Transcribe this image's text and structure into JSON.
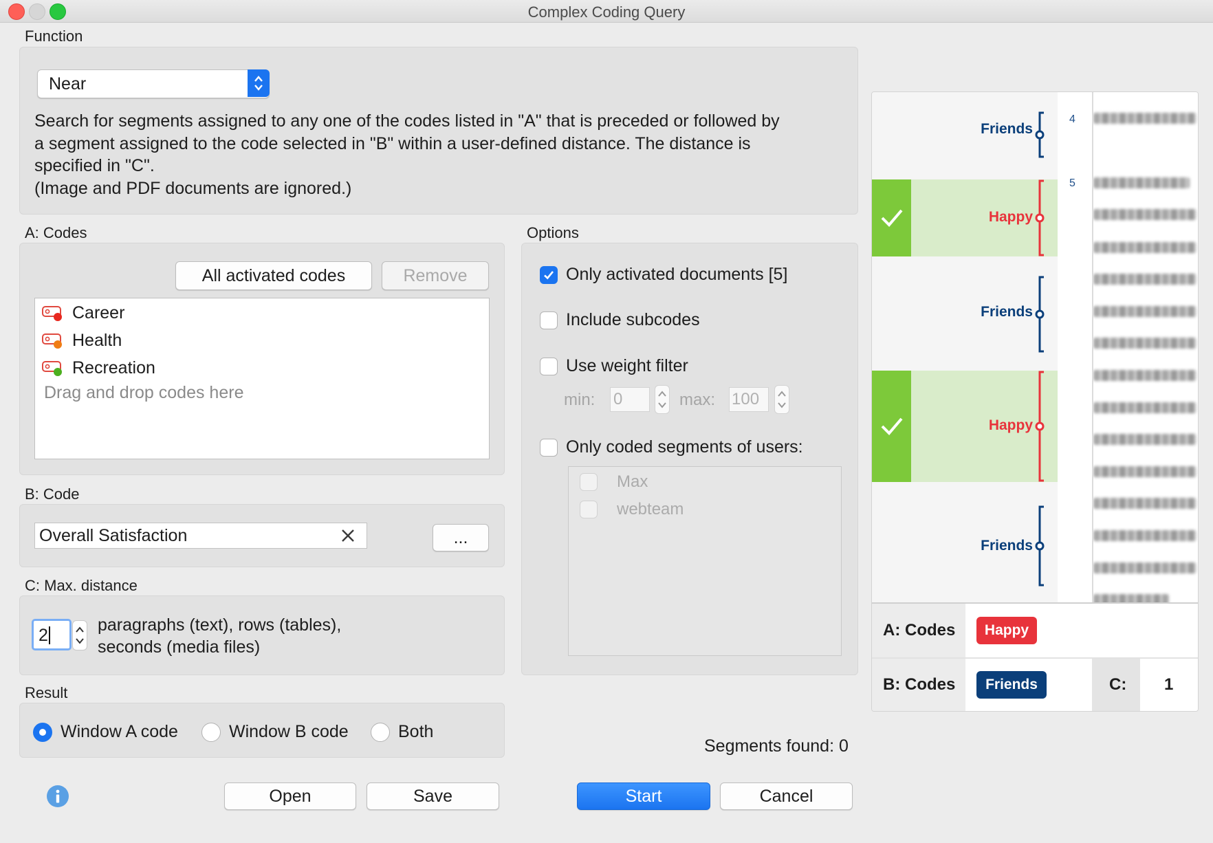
{
  "window": {
    "title": "Complex Coding Query"
  },
  "function": {
    "section_label": "Function",
    "selected": "Near",
    "description": [
      "Search for segments assigned to any one of the codes listed in \"A\" that is preceded or followed by",
      "a segment assigned to the code selected in \"B\" within a user-defined distance. The distance  is",
      "specified in \"C\".",
      "(Image and PDF documents are ignored.)"
    ]
  },
  "codes_a": {
    "section_label": "A: Codes",
    "all_activated_label": "All activated codes",
    "remove_label": "Remove",
    "items": [
      {
        "label": "Career",
        "color": "#e8281f"
      },
      {
        "label": "Health",
        "color": "#f07d14"
      },
      {
        "label": "Recreation",
        "color": "#4caf1f"
      }
    ],
    "drop_hint": "Drag and drop codes here"
  },
  "code_b": {
    "section_label": "B: Code",
    "value": "Overall Satisfaction",
    "browse_label": "..."
  },
  "distance": {
    "section_label": "C: Max. distance",
    "value": "2",
    "unit_line1": "paragraphs (text), rows (tables),",
    "unit_line2": "seconds (media files)"
  },
  "result": {
    "section_label": "Result",
    "options": [
      "Window A code",
      "Window B code",
      "Both"
    ],
    "selected": "Window A code"
  },
  "options": {
    "section_label": "Options",
    "only_activated_docs": {
      "label": "Only activated documents [5]",
      "checked": true
    },
    "include_subcodes": {
      "label": "Include subcodes",
      "checked": false
    },
    "use_weight_filter": {
      "label": "Use weight filter",
      "checked": false
    },
    "weight_min_label": "min:",
    "weight_min": "0",
    "weight_max_label": "max:",
    "weight_max": "100",
    "only_users": {
      "label": "Only coded segments of users:",
      "checked": false
    },
    "users": [
      "Max",
      "webteam"
    ]
  },
  "status": {
    "segments_found": "Segments found: 0"
  },
  "buttons": {
    "open": "Open",
    "save": "Save",
    "start": "Start",
    "cancel": "Cancel"
  },
  "illustration": {
    "line_numbers": [
      "4",
      "5"
    ],
    "segments": [
      {
        "label": "Friends",
        "color": "#0b3f7a",
        "match": false
      },
      {
        "label": "Happy",
        "color": "#e8333b",
        "match": true
      },
      {
        "label": "Friends",
        "color": "#0b3f7a",
        "match": false
      },
      {
        "label": "Happy",
        "color": "#e8333b",
        "match": true
      },
      {
        "label": "Friends",
        "color": "#0b3f7a",
        "match": false
      }
    ],
    "legend": {
      "a_label": "A: Codes",
      "a_code": "Happy",
      "b_label": "B: Codes",
      "b_code": "Friends",
      "c_label": "C:",
      "c_value": "1"
    },
    "colors": {
      "match_green": "#7dc93a",
      "match_bg": "#d9ecca",
      "happy": "#e8333b",
      "friends": "#0b3f7a"
    }
  }
}
